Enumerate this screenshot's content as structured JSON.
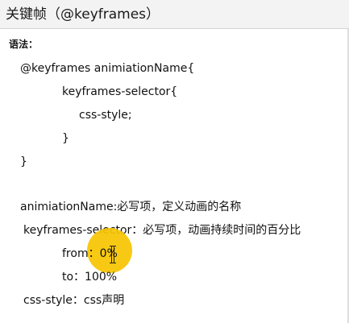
{
  "window": {
    "title": "关键帧（@keyframes）"
  },
  "content": {
    "syntax_label": "语法：",
    "lines": [
      "@keyframes animiationName{",
      "keyframes-selector{",
      "css-style;",
      "}",
      "}",
      "animiationName:必写项，定义动画的名称",
      "keyframes-selector：必写项，动画持续时间的百分比",
      "from：0%",
      "to：100%",
      "css-style：css声明"
    ]
  },
  "cursor": {
    "highlight_color": "#f7c400"
  }
}
